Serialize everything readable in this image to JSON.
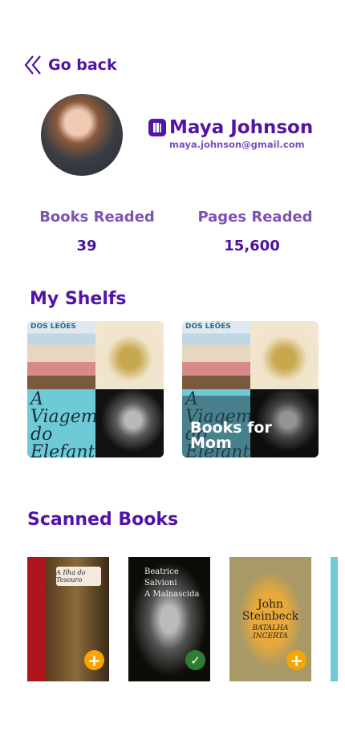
{
  "nav": {
    "back_label": "Go back"
  },
  "profile": {
    "name": "Maya Johnson",
    "email": "maya.johnson@gmail.com"
  },
  "stats": [
    {
      "label": "Books Readed",
      "value": "39"
    },
    {
      "label": "Pages Readed",
      "value": "15,600"
    }
  ],
  "shelves": {
    "title": "My Shelfs",
    "items": [
      {
        "name": ""
      },
      {
        "name": "Books for Mom"
      }
    ]
  },
  "scanned": {
    "title": "Scanned Books",
    "books": [
      {
        "title": "A Ilha do Tesouro",
        "status": "add"
      },
      {
        "author": "Beatrice Salvioni",
        "title": "A Malnascida",
        "status": "added"
      },
      {
        "author": "John Steinbeck",
        "title": "BATALHA INCERTA",
        "status": "add"
      }
    ]
  },
  "cover_text": {
    "dos_leoes": "DOS LEÕES",
    "viagem": "A Viagem do Elefante",
    "malnascida": "A Malnascida"
  },
  "colors": {
    "primary": "#5113a8",
    "add": "#f7a500",
    "added": "#2f7d32"
  }
}
